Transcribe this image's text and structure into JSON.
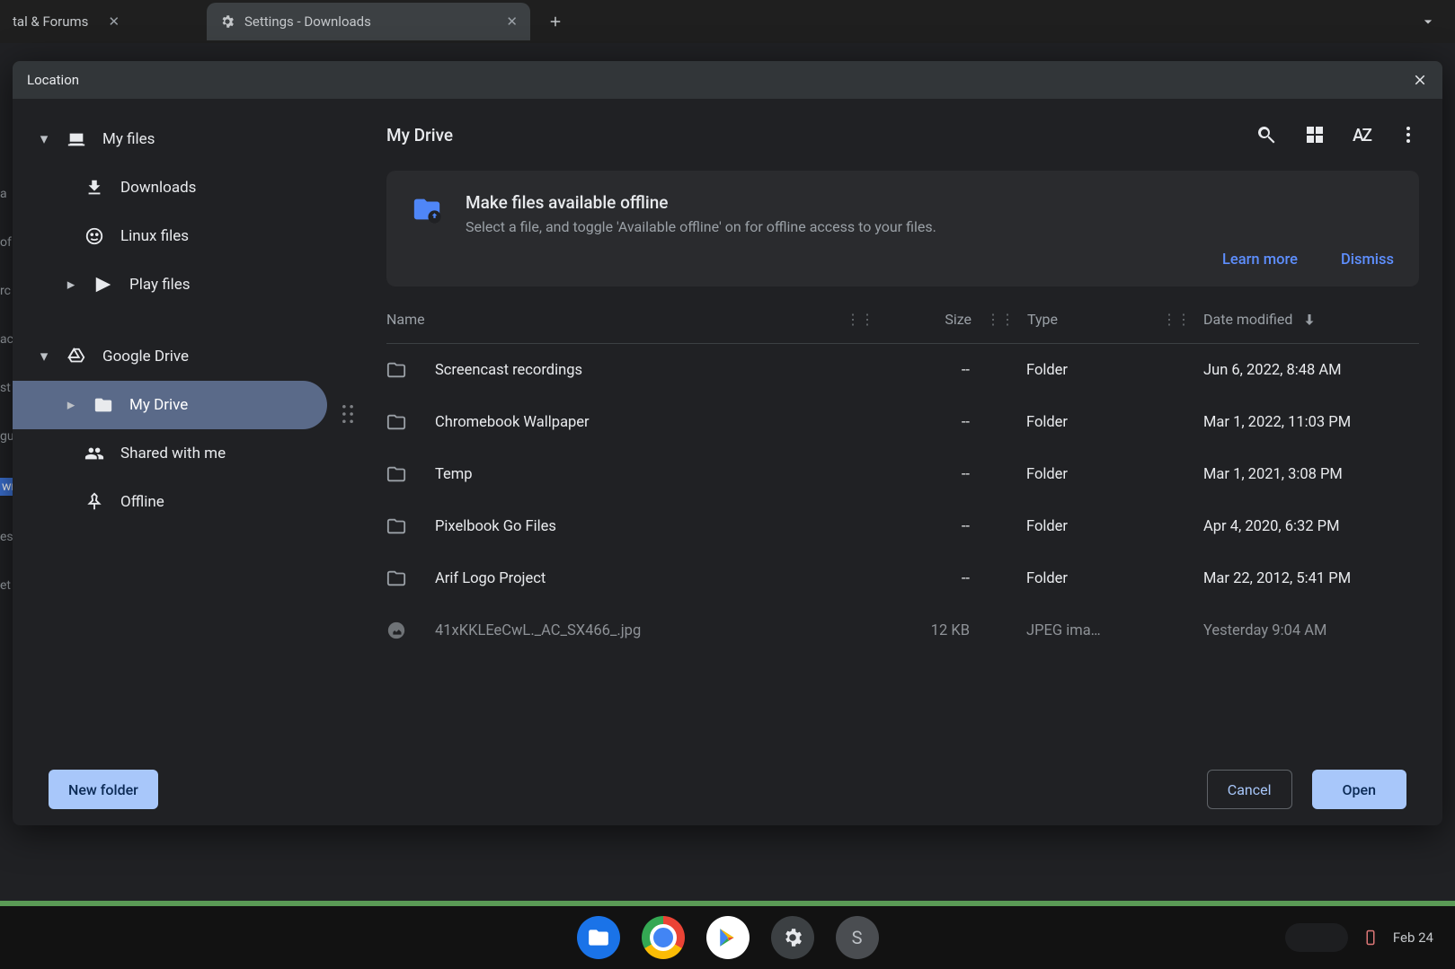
{
  "tabs": {
    "inactive_label": "tal & Forums",
    "active_label": "Settings - Downloads"
  },
  "dialog": {
    "title": "Location"
  },
  "sidebar": {
    "my_files": "My files",
    "downloads": "Downloads",
    "linux": "Linux files",
    "play": "Play files",
    "gdrive": "Google Drive",
    "mydrive": "My Drive",
    "shared": "Shared with me",
    "offline": "Offline"
  },
  "header": {
    "title": "My Drive",
    "sort_label": "AZ"
  },
  "banner": {
    "title": "Make files available offline",
    "subtitle": "Select a file, and toggle 'Available offline' on for offline access to your files.",
    "learn": "Learn more",
    "dismiss": "Dismiss"
  },
  "columns": {
    "name": "Name",
    "size": "Size",
    "type": "Type",
    "date": "Date modified"
  },
  "rows": [
    {
      "name": "Screencast recordings",
      "size": "--",
      "type": "Folder",
      "date": "Jun 6, 2022, 8:48 AM",
      "icon": "folder"
    },
    {
      "name": "Chromebook Wallpaper",
      "size": "--",
      "type": "Folder",
      "date": "Mar 1, 2022, 11:03 PM",
      "icon": "folder"
    },
    {
      "name": "Temp",
      "size": "--",
      "type": "Folder",
      "date": "Mar 1, 2021, 3:08 PM",
      "icon": "folder"
    },
    {
      "name": "Pixelbook Go Files",
      "size": "--",
      "type": "Folder",
      "date": "Apr 4, 2020, 6:32 PM",
      "icon": "folder"
    },
    {
      "name": "Arif Logo Project",
      "size": "--",
      "type": "Folder",
      "date": "Mar 22, 2012, 5:41 PM",
      "icon": "folder"
    },
    {
      "name": "41xKKLEeCwL._AC_SX466_.jpg",
      "size": "12 KB",
      "type": "JPEG ima…",
      "date": "Yesterday 9:04 AM",
      "icon": "image",
      "partial": true
    }
  ],
  "footer": {
    "new_folder": "New folder",
    "cancel": "Cancel",
    "open": "Open"
  },
  "shelf": {
    "date": "Feb 24",
    "letter": "S"
  },
  "behind_sliver": [
    "a",
    "of",
    "rc",
    "ac",
    "st",
    "gu",
    "wn",
    "es",
    "et"
  ]
}
